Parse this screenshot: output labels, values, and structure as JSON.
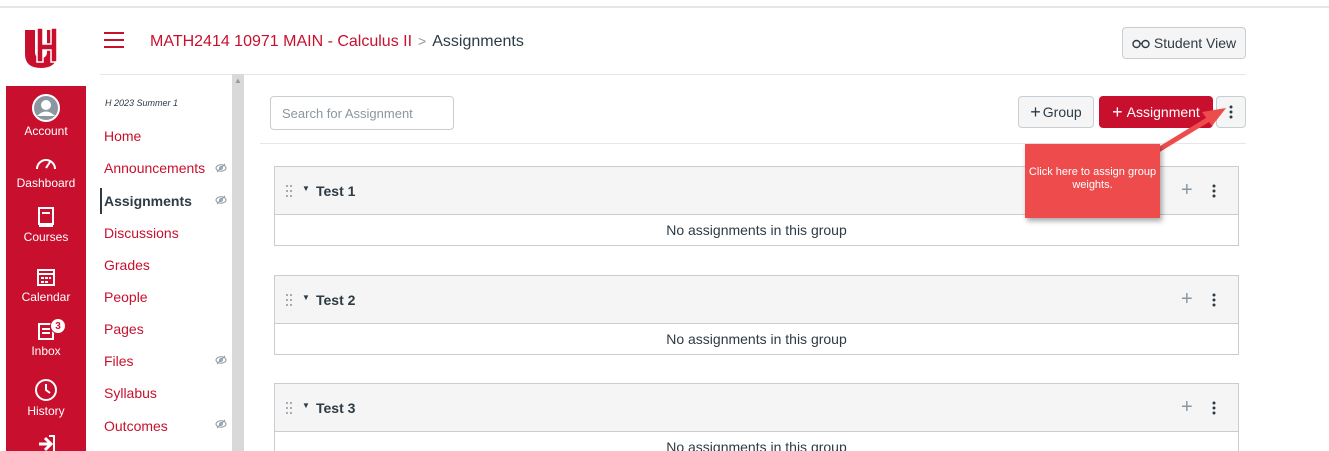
{
  "nav": {
    "items": [
      {
        "label": "Account",
        "icon": "account-icon"
      },
      {
        "label": "Dashboard",
        "icon": "dashboard-icon"
      },
      {
        "label": "Courses",
        "icon": "courses-icon"
      },
      {
        "label": "Calendar",
        "icon": "calendar-icon"
      },
      {
        "label": "Inbox",
        "icon": "inbox-icon",
        "badge": "3"
      },
      {
        "label": "History",
        "icon": "history-icon"
      }
    ]
  },
  "header": {
    "course": "MATH2414 10971 MAIN - Calculus II",
    "separator": ">",
    "current": "Assignments",
    "student_view": "Student View"
  },
  "course_nav": {
    "term": "H 2023 Summer 1",
    "items": [
      {
        "label": "Home"
      },
      {
        "label": "Announcements"
      },
      {
        "label": "Assignments"
      },
      {
        "label": "Discussions"
      },
      {
        "label": "Grades"
      },
      {
        "label": "People"
      },
      {
        "label": "Pages"
      },
      {
        "label": "Files"
      },
      {
        "label": "Syllabus"
      },
      {
        "label": "Outcomes"
      }
    ]
  },
  "toolbar": {
    "search_placeholder": "Search for Assignment",
    "group_label": "Group",
    "assignment_label": "Assignment"
  },
  "groups": [
    {
      "title": "Test 1",
      "empty": "No assignments in this group"
    },
    {
      "title": "Test 2",
      "empty": "No assignments in this group"
    },
    {
      "title": "Test 3",
      "empty": "No assignments in this group"
    }
  ],
  "callout": {
    "text": "Click here to assign group weights."
  },
  "colors": {
    "brand": "#c8102e",
    "callout": "#ee4c4c"
  }
}
